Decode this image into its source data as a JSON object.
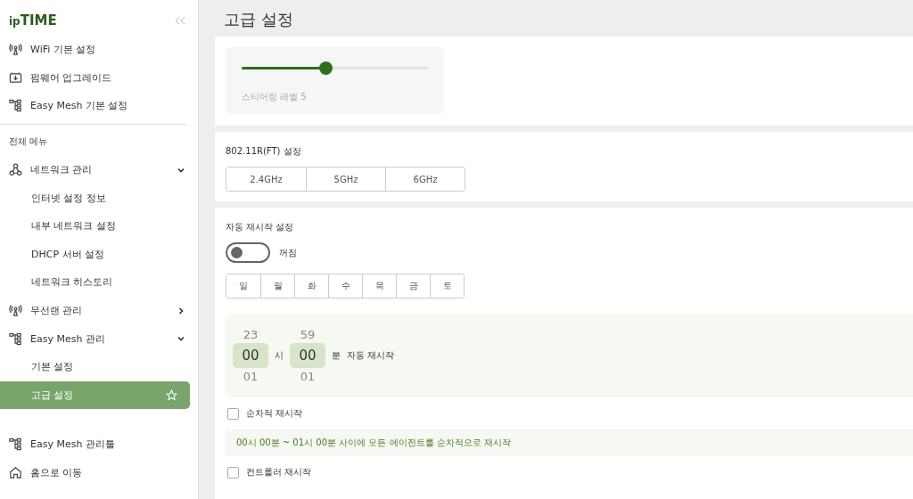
{
  "sidebar": {
    "logo": {
      "prefix": "ip",
      "brand": "TIME"
    },
    "quick_links": [
      {
        "kind": "antenna",
        "label": "WiFi 기본 설정"
      },
      {
        "kind": "firmware",
        "label": "펌웨어 업그레이드"
      },
      {
        "kind": "mesh",
        "label": "Easy Mesh 기본 설정"
      }
    ],
    "section_title": "전체 메뉴",
    "menu": [
      {
        "kind": "network",
        "label": "네트워크 관리",
        "expanded": true,
        "children": [
          {
            "label": "인터넷 설정 정보",
            "selected": false
          },
          {
            "label": "내부 네트워크 설정",
            "selected": false
          },
          {
            "label": "DHCP 서버 설정",
            "selected": false
          },
          {
            "label": "네트워크 히스토리",
            "selected": false
          }
        ]
      },
      {
        "kind": "antenna",
        "label": "무선랜 관리",
        "expanded": false
      },
      {
        "kind": "mesh",
        "label": "Easy Mesh 관리",
        "expanded": true,
        "children": [
          {
            "label": "기본 설정",
            "selected": false
          },
          {
            "label": "고급 설정",
            "selected": true
          }
        ]
      }
    ],
    "footer_links": [
      {
        "kind": "mesh",
        "label": "Easy Mesh 관리툴"
      },
      {
        "kind": "home",
        "label": "홈으로 이동"
      }
    ]
  },
  "page_title": "고급 설정",
  "steering": {
    "level": 0.45,
    "label": "스티어링 레벨 5"
  },
  "ft": {
    "title": "802.11R(FT) 설정",
    "bands": [
      {
        "label": "2.4GHz",
        "selected": false
      },
      {
        "label": "5GHz",
        "selected": false
      },
      {
        "label": "6GHz",
        "selected": false
      }
    ]
  },
  "auto_restart": {
    "title": "자동 재시작 설정",
    "toggle": {
      "on": false,
      "label": "꺼짐"
    },
    "days": [
      {
        "label": "일",
        "selected": false
      },
      {
        "label": "월",
        "selected": false
      },
      {
        "label": "화",
        "selected": false
      },
      {
        "label": "수",
        "selected": false
      },
      {
        "label": "목",
        "selected": false
      },
      {
        "label": "금",
        "selected": false
      },
      {
        "label": "토",
        "selected": false
      }
    ],
    "time": {
      "hour": {
        "prev": "23",
        "value": "00",
        "next": "01",
        "unit": "시"
      },
      "minute": {
        "prev": "59",
        "value": "00",
        "next": "01",
        "unit": "분"
      },
      "suffix": "자동 재시작"
    },
    "sequential": {
      "label": "순차적 재시작",
      "checked": false
    },
    "note": "00시 00분 ~ 01시 00분 사이에 모든 에이전트를 순차적으로 재시작",
    "controller": {
      "label": "컨트롤러 재시작",
      "checked": false
    }
  }
}
